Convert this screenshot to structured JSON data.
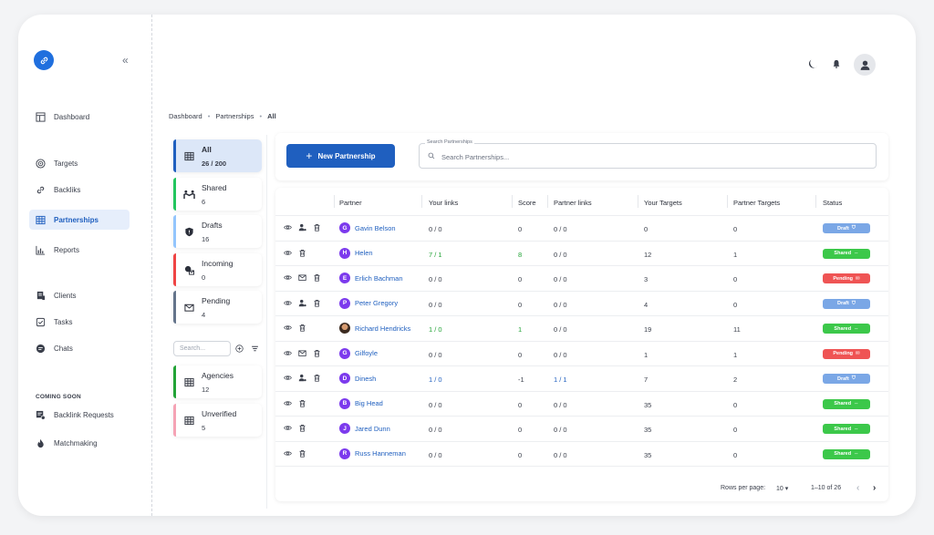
{
  "sidebar": {
    "items": [
      {
        "label": "Dashboard",
        "icon": "dashboard-icon",
        "active": false
      },
      {
        "label": "Targets",
        "icon": "target-icon",
        "active": false
      },
      {
        "label": "Backliks",
        "icon": "link-icon",
        "active": false
      },
      {
        "label": "Partnerships",
        "icon": "table-icon",
        "active": true
      },
      {
        "label": "Reports",
        "icon": "bar-chart-icon",
        "active": false
      },
      {
        "label": "Clients",
        "icon": "clients-icon",
        "active": false
      },
      {
        "label": "Tasks",
        "icon": "tasks-icon",
        "active": false
      },
      {
        "label": "Chats",
        "icon": "chat-icon",
        "active": false
      }
    ],
    "coming_soon_label": "COMING SOON",
    "coming_soon_items": [
      {
        "label": "Backlink Requests",
        "icon": "backlink-requests-icon"
      },
      {
        "label": "Matchmaking",
        "icon": "flame-icon"
      }
    ]
  },
  "breadcrumb": [
    "Dashboard",
    "Partnerships",
    "All"
  ],
  "categories": [
    {
      "label": "All",
      "count": "26 / 200",
      "color": "#1f5fbf",
      "icon": "table-icon"
    },
    {
      "label": "Shared",
      "count": "6",
      "color": "#22c55e",
      "icon": "handshake-icon"
    },
    {
      "label": "Drafts",
      "count": "16",
      "color": "#93c5fd",
      "icon": "shield-icon"
    },
    {
      "label": "Incoming",
      "count": "0",
      "color": "#ef4444",
      "icon": "incoming-icon"
    },
    {
      "label": "Pending",
      "count": "4",
      "color": "#64748b",
      "icon": "mail-icon"
    }
  ],
  "mini_search_placeholder": "Search...",
  "groups": [
    {
      "label": "Agencies",
      "count": "12",
      "color": "#22a336"
    },
    {
      "label": "Unverified",
      "count": "5",
      "color": "#f5a3b5"
    }
  ],
  "toolbar": {
    "new_button": "New Partnership",
    "search_label": "Search Partnerships",
    "search_placeholder": "Search Partnerships..."
  },
  "table": {
    "headers": [
      "Partner",
      "Your links",
      "Score",
      "Partner links",
      "Your Targets",
      "Partner Targets",
      "Status"
    ],
    "rows": [
      {
        "initial": "G",
        "name": "Gavin Belson",
        "your_links": "0 / 0",
        "score": "0",
        "partner_links": "0 / 0",
        "your_targets": "0",
        "partner_targets": "0",
        "status": "Draft",
        "extra_action": true,
        "photo": false
      },
      {
        "initial": "H",
        "name": "Helen",
        "your_links": "7 / 1",
        "score": "8",
        "partner_links": "0 / 0",
        "your_targets": "12",
        "partner_targets": "1",
        "status": "Shared",
        "extra_action": false,
        "photo": false
      },
      {
        "initial": "E",
        "name": "Erlich Bachman",
        "your_links": "0 / 0",
        "score": "0",
        "partner_links": "0 / 0",
        "your_targets": "3",
        "partner_targets": "0",
        "status": "Pending",
        "extra_action": true,
        "photo": false
      },
      {
        "initial": "P",
        "name": "Peter Gregory",
        "your_links": "0 / 0",
        "score": "0",
        "partner_links": "0 / 0",
        "your_targets": "4",
        "partner_targets": "0",
        "status": "Draft",
        "extra_action": true,
        "photo": false
      },
      {
        "initial": "",
        "name": "Richard Hendricks",
        "your_links": "1 / 0",
        "score": "1",
        "partner_links": "0 / 0",
        "your_targets": "19",
        "partner_targets": "11",
        "status": "Shared",
        "extra_action": false,
        "photo": true
      },
      {
        "initial": "G",
        "name": "Gilfoyle",
        "your_links": "0 / 0",
        "score": "0",
        "partner_links": "0 / 0",
        "your_targets": "1",
        "partner_targets": "1",
        "status": "Pending",
        "extra_action": true,
        "photo": false
      },
      {
        "initial": "D",
        "name": "Dinesh",
        "your_links": "1 / 0",
        "score": "-1",
        "partner_links": "1 / 1",
        "your_targets": "7",
        "partner_targets": "2",
        "status": "Draft",
        "extra_action": true,
        "photo": false
      },
      {
        "initial": "B",
        "name": "Big Head",
        "your_links": "0 / 0",
        "score": "0",
        "partner_links": "0 / 0",
        "your_targets": "35",
        "partner_targets": "0",
        "status": "Shared",
        "extra_action": false,
        "photo": false
      },
      {
        "initial": "J",
        "name": "Jared Dunn",
        "your_links": "0 / 0",
        "score": "0",
        "partner_links": "0 / 0",
        "your_targets": "35",
        "partner_targets": "0",
        "status": "Shared",
        "extra_action": false,
        "photo": false
      },
      {
        "initial": "R",
        "name": "Russ Hanneman",
        "your_links": "0 / 0",
        "score": "0",
        "partner_links": "0 / 0",
        "your_targets": "35",
        "partner_targets": "0",
        "status": "Shared",
        "extra_action": false,
        "photo": false
      }
    ]
  },
  "status_colors": {
    "Draft": "#7aa7e6",
    "Shared": "#3cc84a",
    "Pending": "#ef5454"
  },
  "pagination": {
    "rows_per_page_label": "Rows per page:",
    "rows_per_page": "10",
    "range": "1–10 of 26"
  }
}
